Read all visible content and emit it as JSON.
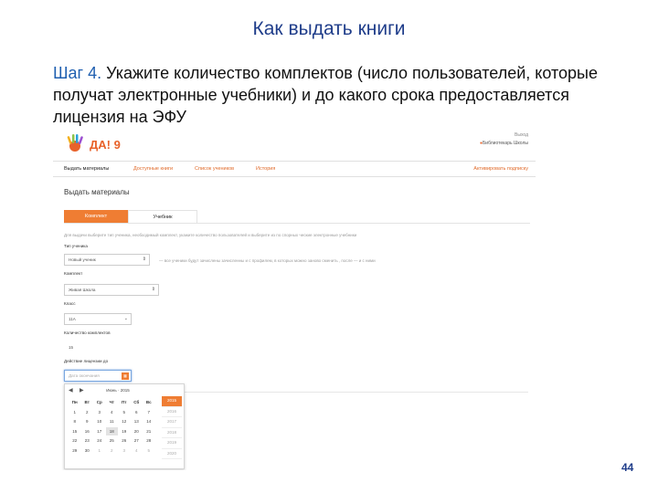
{
  "slide": {
    "title": "Как выдать книги",
    "step_label": "Шаг 4.",
    "step_text": " Укажите количество комплектов (число пользователей, которые получат электронные учебники) и до какого срока предоставляется лицензия на ЭФУ",
    "page_number": "44"
  },
  "app": {
    "logo_text": "ДА! 9",
    "top_link": "Выход",
    "user": "Библиотекарь Школы",
    "nav": {
      "items": [
        "Выдать материалы",
        "Доступные книги",
        "Список учеников",
        "История"
      ],
      "right": "Активировать подписку"
    },
    "page_heading": "Выдать материалы",
    "tabs": [
      "Комплект",
      "Учебник"
    ],
    "description": "Для выдачи выберите тип ученика, необходимый комплект, укажите количество пользователей и выберите из по спорных  ческие электронные учебники ",
    "form": {
      "type_label": "Тип ученика",
      "type_value": "Новый ученик",
      "type_hint": "— все ученики будут зачислены зачисленны и с профилем, в которых можно заново сменить  , после — и с ними",
      "kit_label": "Комплект",
      "kit_value": "Живая Школа",
      "grade_label": "Класс",
      "grade_value": "11А",
      "count_label": "Количество комплектов",
      "count_value": "15",
      "date_label": "Действие лицензии до",
      "date_placeholder": "Дата окончания"
    },
    "datepicker": {
      "prev": "◀",
      "next": "▶",
      "month": "Июнь · 2015",
      "weekdays": [
        "Пн",
        "Вт",
        "Ср",
        "Чт",
        "Пт",
        "Сб",
        "Вс"
      ],
      "weeks": [
        [
          "1",
          "2",
          "3",
          "4",
          "5",
          "6",
          "7"
        ],
        [
          "8",
          "9",
          "10",
          "11",
          "12",
          "13",
          "14"
        ],
        [
          "15",
          "16",
          "17",
          "18",
          "19",
          "20",
          "21"
        ],
        [
          "22",
          "23",
          "24",
          "25",
          "26",
          "27",
          "28"
        ],
        [
          "29",
          "30",
          "1",
          "2",
          "3",
          "4",
          "5"
        ]
      ],
      "years": [
        "2015",
        "2016",
        "2017",
        "2018",
        "2019",
        "2020"
      ],
      "selected_year": "2015"
    }
  }
}
